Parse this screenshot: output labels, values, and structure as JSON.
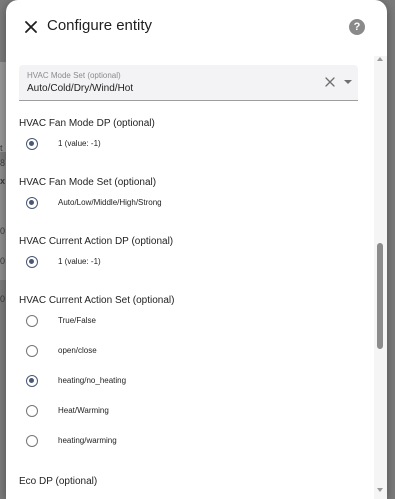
{
  "dialog": {
    "title": "Configure entity",
    "close_icon": "close-icon",
    "help_icon": "help-circle-icon",
    "help_glyph": "?"
  },
  "background": {
    "fragments": [
      "t",
      "8",
      "x",
      "0",
      "0",
      "0"
    ]
  },
  "hvac_mode_set": {
    "label": "HVAC Mode Set (optional)",
    "value": "Auto/Cold/Dry/Wind/Hot"
  },
  "sections": [
    {
      "label": "HVAC Fan Mode DP (optional)",
      "options": [
        {
          "label": "1 (value: -1)",
          "checked": true
        }
      ]
    },
    {
      "label": "HVAC Fan Mode Set (optional)",
      "options": [
        {
          "label": "Auto/Low/Middle/High/Strong",
          "checked": true
        }
      ]
    },
    {
      "label": "HVAC Current Action DP (optional)",
      "options": [
        {
          "label": "1 (value: -1)",
          "checked": true
        }
      ]
    },
    {
      "label": "HVAC Current Action Set (optional)",
      "options": [
        {
          "label": "True/False",
          "checked": false
        },
        {
          "label": "open/close",
          "checked": false
        },
        {
          "label": "heating/no_heating",
          "checked": true
        },
        {
          "label": "Heat/Warming",
          "checked": false
        },
        {
          "label": "heating/warming",
          "checked": false
        }
      ]
    },
    {
      "label": "Eco DP (optional)",
      "options": []
    }
  ],
  "colors": {
    "radio_checked": "#4a5876",
    "radio_unchecked": "#757575"
  }
}
